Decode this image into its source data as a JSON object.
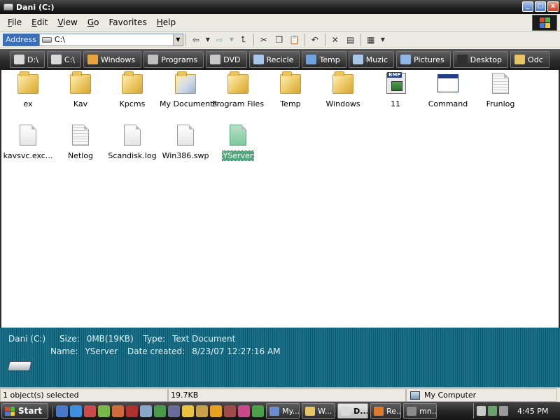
{
  "window": {
    "title": "Dani (C:)",
    "controls": {
      "minimize": "_",
      "maximize": "□",
      "close": "x"
    }
  },
  "menu": {
    "items": [
      {
        "label": "File",
        "key": "F",
        "rest": "ile"
      },
      {
        "label": "Edit",
        "key": "E",
        "rest": "dit"
      },
      {
        "label": "View",
        "key": "V",
        "rest": "iew"
      },
      {
        "label": "Go",
        "key": "G",
        "rest": "o"
      },
      {
        "label": "Favorites",
        "key": "",
        "rest": "Favorites"
      },
      {
        "label": "Help",
        "key": "H",
        "rest": "elp"
      }
    ]
  },
  "address": {
    "label": "Address",
    "value": "C:\\"
  },
  "links": [
    {
      "label": "D:\\",
      "icon": "drive-icon",
      "color": "#d9d9d9"
    },
    {
      "label": "C:\\",
      "icon": "drive-icon",
      "color": "#d9d9d9"
    },
    {
      "label": "Windows",
      "icon": "windows-icon",
      "color": "#e8a33d"
    },
    {
      "label": "Programs",
      "icon": "gear-icon",
      "color": "#bfbfbf"
    },
    {
      "label": "DVD",
      "icon": "disc-icon",
      "color": "#c9c9c9"
    },
    {
      "label": "Recicle",
      "icon": "recycle-bin-icon",
      "color": "#a9c6e8"
    },
    {
      "label": "Temp",
      "icon": "arrows-icon",
      "color": "#6fa3e0"
    },
    {
      "label": "Muzic",
      "icon": "music-icon",
      "color": "#a9c6e8"
    },
    {
      "label": "Pictures",
      "icon": "pictures-icon",
      "color": "#8fb6e6"
    },
    {
      "label": "Desktop",
      "icon": "desktop-icon",
      "color": "#303030"
    },
    {
      "label": "Odc",
      "icon": "folder-icon",
      "color": "#e8c463"
    }
  ],
  "files": [
    {
      "name": "ex",
      "type": "folder",
      "selected": false
    },
    {
      "name": "Kav",
      "type": "folder",
      "selected": false
    },
    {
      "name": "Kpcms",
      "type": "folder",
      "selected": false
    },
    {
      "name": "My Documents",
      "type": "mydocs",
      "selected": false
    },
    {
      "name": "Program Files",
      "type": "folder",
      "selected": false
    },
    {
      "name": "Temp",
      "type": "folder",
      "selected": false
    },
    {
      "name": "Windows",
      "type": "folder",
      "selected": false
    },
    {
      "name": "11",
      "type": "bmp",
      "badge": "BMP",
      "selected": false
    },
    {
      "name": "Command",
      "type": "app",
      "selected": false
    },
    {
      "name": "Frunlog",
      "type": "textdoc",
      "selected": false
    },
    {
      "name": "kavsvc.exc...",
      "type": "doc",
      "selected": false
    },
    {
      "name": "Netlog",
      "type": "textdoc",
      "selected": false
    },
    {
      "name": "Scandisk.log",
      "type": "doc",
      "selected": false
    },
    {
      "name": "Win386.swp",
      "type": "doc",
      "selected": false
    },
    {
      "name": "YServer",
      "type": "textdoc-green",
      "selected": true
    }
  ],
  "details": {
    "title": "Dani (C:)",
    "size_label": "Size:",
    "size_value": "0MB(19KB)",
    "type_label": "Type:",
    "type_value": "Text Document",
    "name_label": "Name:",
    "name_value": "YServer",
    "date_label": "Date created:",
    "date_value": "8/23/07 12:27:16 AM"
  },
  "status": {
    "selection": "1 object(s) selected",
    "size": "19.7KB",
    "zone": "My Computer"
  },
  "taskbar": {
    "start": "Start",
    "tasks": [
      {
        "label": "My...",
        "color": "#6a8fd1",
        "active": false
      },
      {
        "label": "W...",
        "color": "#e8c463",
        "active": false
      },
      {
        "label": "D...",
        "color": "#d9d9d9",
        "active": true
      },
      {
        "label": "Re...",
        "color": "#e07a2b",
        "active": false
      },
      {
        "label": "mn...",
        "color": "#8a8a8a",
        "active": false
      }
    ],
    "clock": "4:45 PM"
  }
}
